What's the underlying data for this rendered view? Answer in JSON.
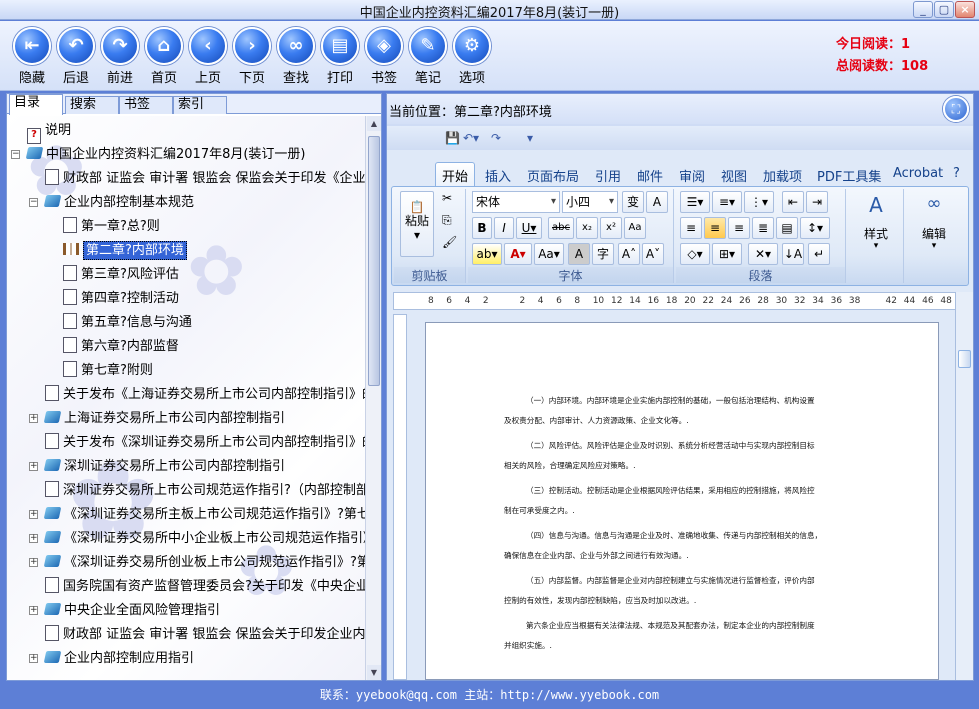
{
  "window": {
    "title": "中国企业内控资料汇编2017年8月(装订一册)"
  },
  "toolbar": [
    {
      "label": "隐藏",
      "icon": "hide-icon",
      "glyph": "⇤"
    },
    {
      "label": "后退",
      "icon": "back-icon",
      "glyph": "↶"
    },
    {
      "label": "前进",
      "icon": "forward-icon",
      "glyph": "↷"
    },
    {
      "label": "首页",
      "icon": "home-icon",
      "glyph": "⌂"
    },
    {
      "label": "上页",
      "icon": "prev-page-icon",
      "glyph": "‹"
    },
    {
      "label": "下页",
      "icon": "next-page-icon",
      "glyph": "›"
    },
    {
      "label": "查找",
      "icon": "binoculars-icon",
      "glyph": "∞"
    },
    {
      "label": "打印",
      "icon": "printer-icon",
      "glyph": "▤"
    },
    {
      "label": "书签",
      "icon": "bookmark-icon",
      "glyph": "◈"
    },
    {
      "label": "笔记",
      "icon": "note-icon",
      "glyph": "✎"
    },
    {
      "label": "选项",
      "icon": "gear-icon",
      "glyph": "⚙"
    }
  ],
  "stats": {
    "today": "今日阅读：1",
    "total": "总阅读数：108"
  },
  "tabs": [
    "目录",
    "搜索",
    "书签",
    "索引"
  ],
  "tree": [
    {
      "label": "说明",
      "icon": "help"
    },
    {
      "label": "中国企业内控资料汇编2017年8月(装订一册)",
      "icon": "book"
    },
    {
      "label": "财政部 证监会 审计署 银监会 保监会关于印发《企业",
      "icon": "doc"
    },
    {
      "label": "企业内部控制基本规范",
      "icon": "book"
    },
    {
      "label": "第一章?总?则",
      "icon": "doc"
    },
    {
      "label": "第二章?内部环境",
      "icon": "open"
    },
    {
      "label": "第三章?风险评估",
      "icon": "doc"
    },
    {
      "label": "第四章?控制活动",
      "icon": "doc"
    },
    {
      "label": "第五章?信息与沟通",
      "icon": "doc"
    },
    {
      "label": "第六章?内部监督",
      "icon": "doc"
    },
    {
      "label": "第七章?附则",
      "icon": "doc"
    },
    {
      "label": "关于发布《上海证券交易所上市公司内部控制指引》的",
      "icon": "doc"
    },
    {
      "label": "上海证券交易所上市公司内部控制指引",
      "icon": "book"
    },
    {
      "label": "关于发布《深圳证券交易所上市公司内部控制指引》的",
      "icon": "doc"
    },
    {
      "label": "深圳证券交易所上市公司内部控制指引",
      "icon": "book"
    },
    {
      "label": "深圳证券交易所上市公司规范运作指引?（内部控制部分",
      "icon": "doc"
    },
    {
      "label": "《深圳证券交易所主板上市公司规范运作指引》?第七章",
      "icon": "book"
    },
    {
      "label": "《深圳证券交易所中小企业板上市公司规范运作指引》",
      "icon": "book"
    },
    {
      "label": "《深圳证券交易所创业板上市公司规范运作指引》?第七",
      "icon": "book"
    },
    {
      "label": "国务院国有资产监督管理委员会?关于印发《中央企业全",
      "icon": "doc"
    },
    {
      "label": "中央企业全面风险管理指引",
      "icon": "book"
    },
    {
      "label": "财政部 证监会 审计署 银监会 保监会关于印发企业内",
      "icon": "doc"
    },
    {
      "label": "企业内部控制应用指引",
      "icon": "book"
    }
  ],
  "location": {
    "label": "当前位置：",
    "value": "第二章?内部环境"
  },
  "word": {
    "ribbon_tabs": [
      "开始",
      "插入",
      "页面布局",
      "引用",
      "邮件",
      "审阅",
      "视图",
      "加载项",
      "PDF工具集",
      "Acrobat"
    ],
    "font_name": "宋体",
    "font_size": "小四",
    "paste": "粘贴",
    "groups": {
      "clipboard": "剪贴板",
      "font": "字体",
      "paragraph": "段落",
      "styles": "样式",
      "editing": "编辑"
    },
    "ruler_ticks": [
      "8",
      "6",
      "4",
      "2",
      "",
      "2",
      "4",
      "6",
      "8",
      "10",
      "12",
      "14",
      "16",
      "18",
      "20",
      "22",
      "24",
      "26",
      "28",
      "30",
      "32",
      "34",
      "36",
      "38",
      "",
      "42",
      "44",
      "46",
      "48"
    ],
    "paragraphs": [
      "（一）内部环境。内部环境是企业实施内部控制的基础，一般包括治理结构、机构设置",
      "及权责分配、内部审计、人力资源政策、企业文化等。.",
      "（二）风险评估。风险评估是企业及时识别、系统分析经营活动中与实现内部控制目标",
      "相关的风险，合理确定风险应对策略。.",
      "（三）控制活动。控制活动是企业根据风险评估结果，采用相应的控制措施，将风险控",
      "制在可承受度之内。.",
      "（四）信息与沟通。信息与沟通是企业及时、准确地收集、传递与内部控制相关的信息，",
      "确保信息在企业内部、企业与外部之间进行有效沟通。.",
      "（五）内部监督。内部监督是企业对内部控制建立与实施情况进行监督检查，评价内部",
      "控制的有效性，发现内部控制缺陷，应当及时加以改进。.",
      "第六条企业应当根据有关法律法规、本规范及其配套办法，制定本企业的内部控制制度",
      "并组织实施。."
    ]
  },
  "footer": "联系：yyebook@qq.com 主站：http://www.yyebook.com"
}
